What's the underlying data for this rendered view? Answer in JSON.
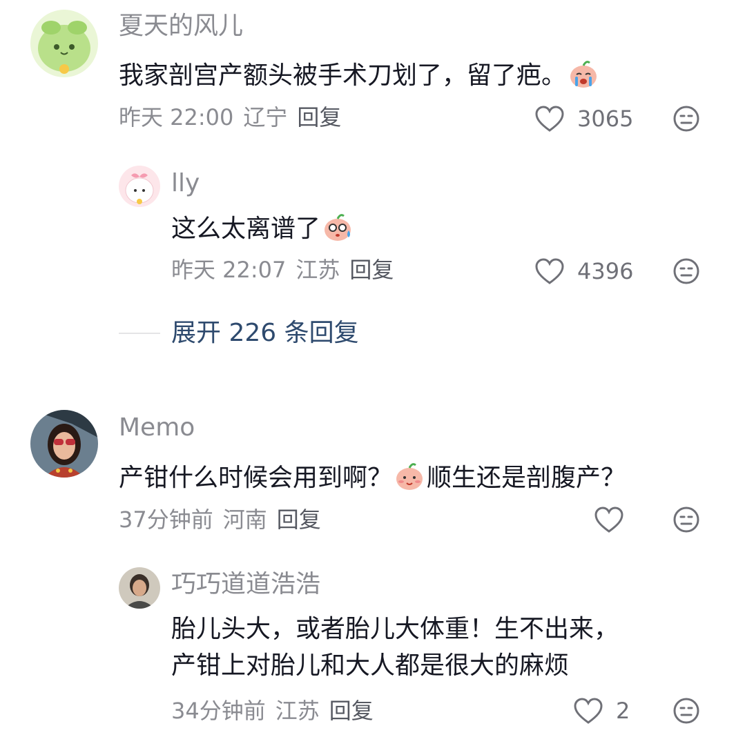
{
  "comments": [
    {
      "user": "夏天的风儿",
      "text_before": "我家剖宫产额头被手术刀划了，留了疤。",
      "emoji": "crying-face-emoji",
      "time": "昨天 22:00",
      "location": "辽宁",
      "reply_label": "回复",
      "likes": "3065",
      "reply": {
        "user": "lly",
        "text_before": "这么太离谱了",
        "emoji": "shocked-face-emoji",
        "time": "昨天 22:07",
        "location": "江苏",
        "reply_label": "回复",
        "likes": "4396"
      },
      "expand_label": "展开 226 条回复"
    },
    {
      "user": "Memo",
      "text_before": "产钳什么时候会用到啊？",
      "emoji": "shy-face-emoji",
      "text_after": "顺生还是剖腹产？",
      "time": "37分钟前",
      "location": "河南",
      "reply_label": "回复",
      "likes": "",
      "reply": {
        "user": "巧巧道道浩浩",
        "line1": "胎儿头大，或者胎儿大体重！生不出来，",
        "line2": "产钳上对胎儿和大人都是很大的麻烦",
        "time": "34分钟前",
        "location": "江苏",
        "reply_label": "回复",
        "likes": "2"
      }
    }
  ],
  "colors": {
    "text": "#161823",
    "meta": "#8a8b91",
    "expand": "#2e4a6e"
  }
}
